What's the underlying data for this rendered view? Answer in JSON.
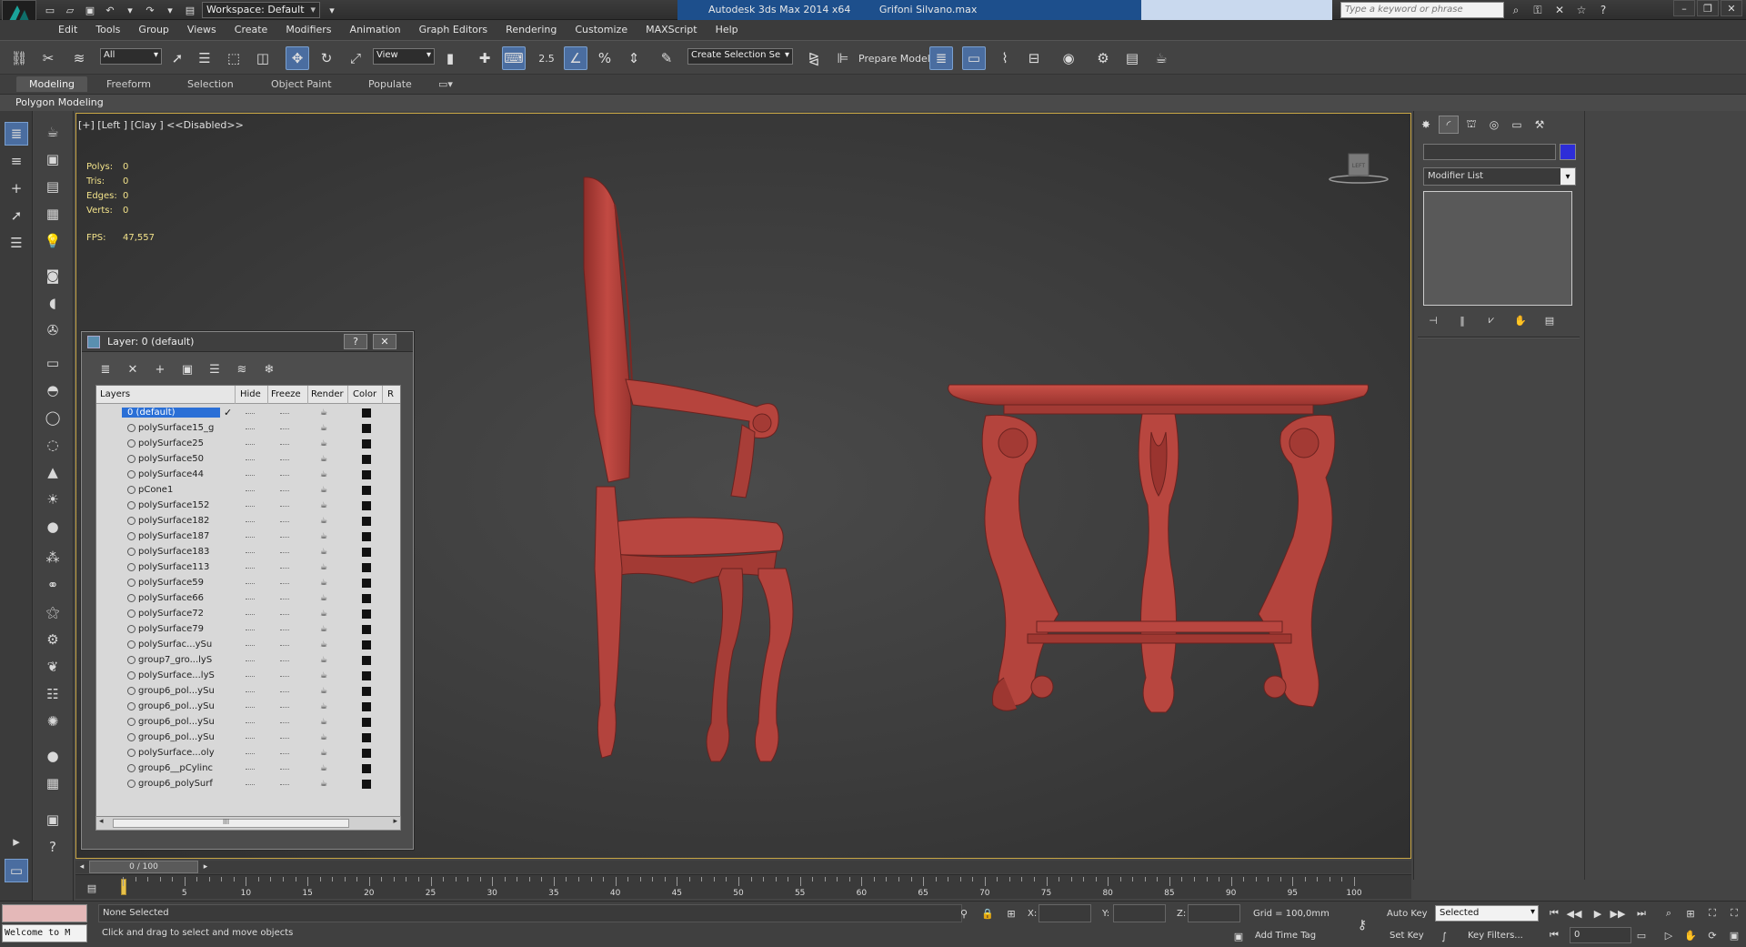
{
  "titlebar": {
    "workspace_label": "Workspace: Default",
    "app_title": "Autodesk 3ds Max  2014 x64",
    "file_name": "Grifoni Silvano.max",
    "search_placeholder": "Type a keyword or phrase"
  },
  "menu": {
    "items": [
      "Edit",
      "Tools",
      "Group",
      "Views",
      "Create",
      "Modifiers",
      "Animation",
      "Graph Editors",
      "Rendering",
      "Customize",
      "MAXScript",
      "Help"
    ]
  },
  "toolbar": {
    "selection_filter": "All",
    "reference_coord": "View",
    "snap_value": "2.5",
    "named_selection": "Create Selection Se",
    "prepare_model": "Prepare Model"
  },
  "ribbon": {
    "tabs": [
      "Modeling",
      "Freeform",
      "Selection",
      "Object Paint",
      "Populate"
    ],
    "panel_label": "Polygon Modeling"
  },
  "viewport": {
    "label": "[+] [Left ] [Clay ]  <<Disabled>>",
    "stats": [
      {
        "k": "Polys:",
        "v": "0"
      },
      {
        "k": "Tris:",
        "v": "0"
      },
      {
        "k": "Edges:",
        "v": "0"
      },
      {
        "k": "Verts:",
        "v": "0"
      }
    ],
    "fps_label": "FPS:",
    "fps_value": "47,557",
    "viewcube_label": "LEFT"
  },
  "layer_dialog": {
    "title": "Layer: 0 (default)",
    "help_label": "?",
    "close_label": "✕",
    "columns": [
      "Layers",
      "Hide",
      "Freeze",
      "Render",
      "Color",
      "R"
    ],
    "rows": [
      "0 (default)",
      "polySurface15_g",
      "polySurface25",
      "polySurface50",
      "polySurface44",
      "pCone1",
      "polySurface152",
      "polySurface182",
      "polySurface187",
      "polySurface183",
      "polySurface113",
      "polySurface59",
      "polySurface66",
      "polySurface72",
      "polySurface79",
      "polySurfac...ySu",
      "group7_gro...lyS",
      "polySurface...lyS",
      "group6_pol...ySu",
      "group6_pol...ySu",
      "group6_pol...ySu",
      "group6_pol...ySu",
      "polySurface...oly",
      "group6__pCylinc",
      "group6_polySurf"
    ],
    "scroll_mid": "III"
  },
  "command_panel": {
    "modifier_list": "Modifier List",
    "object_color": "#2d2dd8"
  },
  "timeline": {
    "position": "0 / 100",
    "ticks": [
      "0",
      "5",
      "10",
      "15",
      "20",
      "25",
      "30",
      "35",
      "40",
      "45",
      "50",
      "55",
      "60",
      "65",
      "70",
      "75",
      "80",
      "85",
      "90",
      "95",
      "100"
    ]
  },
  "status": {
    "welcome": "Welcome to M",
    "selection_status": "None Selected",
    "prompt": "Click and drag to select and move objects",
    "x_label": "X:",
    "y_label": "Y:",
    "z_label": "Z:",
    "grid": "Grid = 100,0mm",
    "add_time_tag": "Add Time Tag",
    "auto_key": "Auto Key",
    "set_key": "Set Key",
    "key_mode": "Selected",
    "key_filters": "Key Filters...",
    "current_frame": "0"
  },
  "colors": {
    "model_red": "#b9433c",
    "viewport_border": "#c8a645",
    "selection_blue": "#2a6fd6",
    "title_blue": "#1d4f8c"
  }
}
